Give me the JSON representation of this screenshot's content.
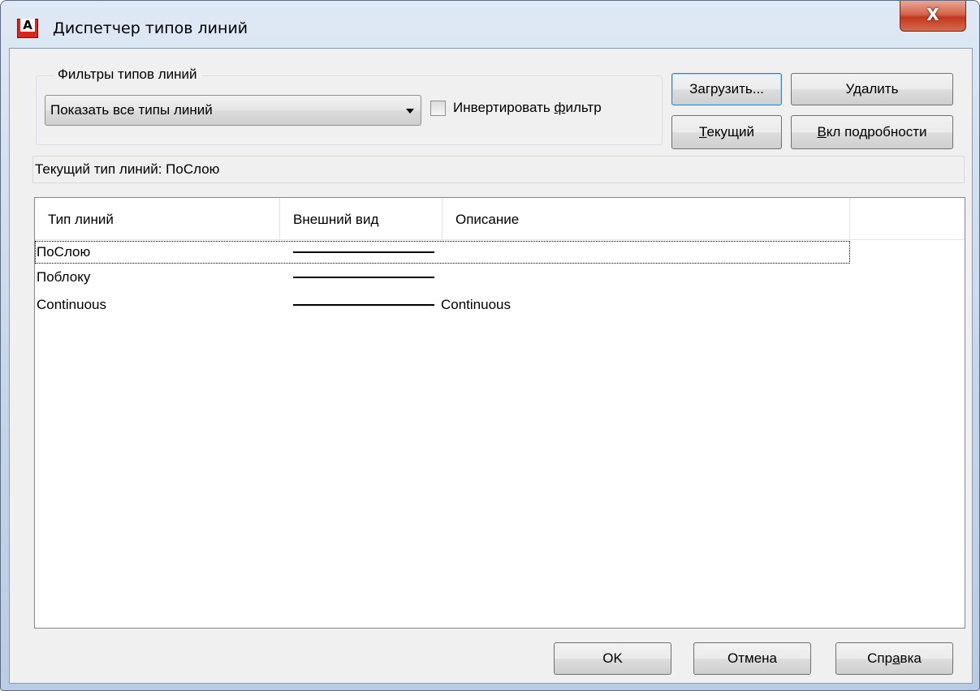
{
  "window": {
    "title": "Диспетчер типов линий",
    "close_glyph": "X",
    "app_icon_glyph": "A",
    "accent_colors": {
      "title_bar": "#c4d5ea",
      "close_button": "#c2381f",
      "app_icon": "#d8261c"
    }
  },
  "filters": {
    "group_label": "Фильтры типов линий",
    "dropdown_selected": "Показать все типы линий",
    "invert_label_before": "Инвертировать ",
    "invert_label_u": "ф",
    "invert_label_after": "ильтр",
    "invert_checked": false
  },
  "buttons": {
    "load": "Загрузить...",
    "delete": "Удалить",
    "current_u": "Т",
    "current_rest": "екущий",
    "details_u": "В",
    "details_rest": "кл подробности",
    "ok": "OK",
    "cancel": "Отмена",
    "help_before": "Спр",
    "help_u": "а",
    "help_after": "вка"
  },
  "status": {
    "current_linetype": "Текущий тип линий:  ПоСлою"
  },
  "list": {
    "columns": [
      "Тип линий",
      "Внешний вид",
      "Описание"
    ],
    "rows": [
      {
        "name": "ПоСлою",
        "appearance": "solid",
        "description": ""
      },
      {
        "name": "Поблоку",
        "appearance": "solid",
        "description": ""
      },
      {
        "name": "Continuous",
        "appearance": "solid",
        "description": "Continuous"
      }
    ]
  }
}
